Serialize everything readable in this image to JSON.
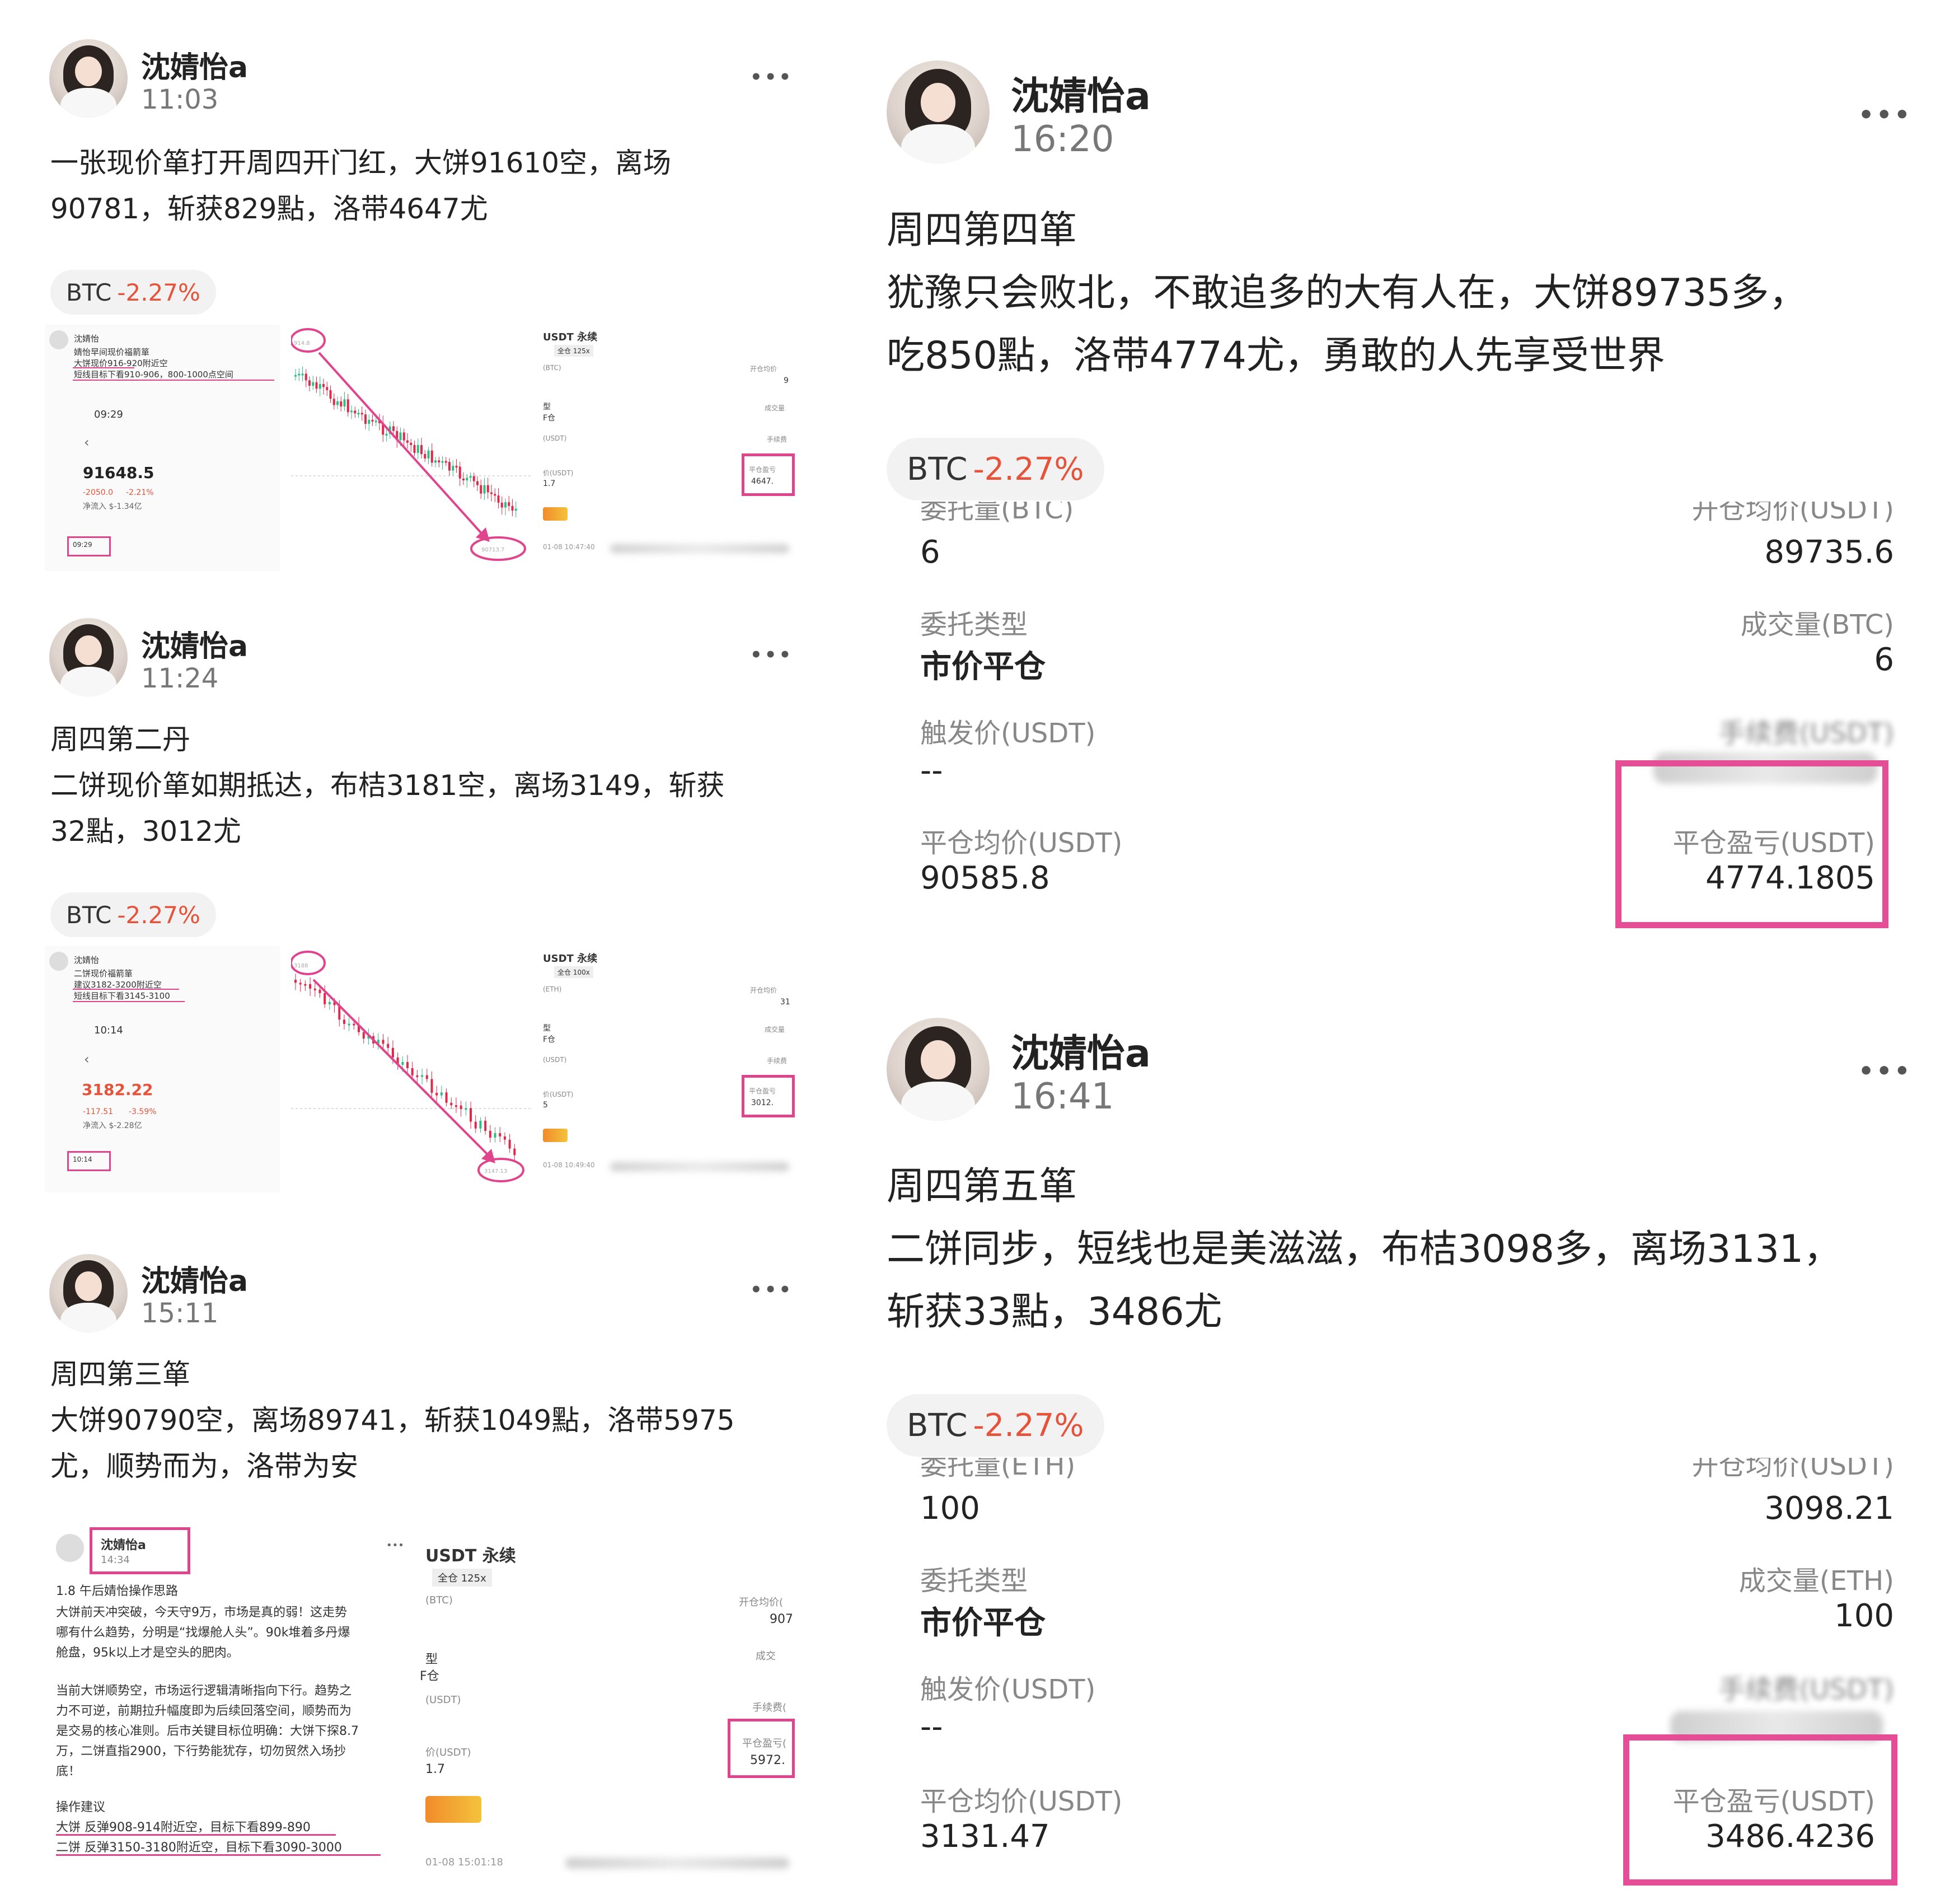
{
  "author": "沈婧怡a",
  "more": "•••",
  "badge": {
    "symbol": "BTC",
    "change": "-2.27%"
  },
  "posts": [
    {
      "time": "11:03",
      "lines": [
        "一张现价箪打开周四开门红，大饼91610空，离场",
        "90781，斩获829點，洛带4647尤"
      ],
      "shot": {
        "name": "沈婧怡",
        "note1": "婧怡早间现价福箭箪",
        "note2": "大饼现价916-920附近空",
        "note3": "短线目标下看910-906，800-1000点空间",
        "ctime": "09:29",
        "price": "91648.5",
        "chg_abs": "-2050.0",
        "chg_pct": "-2.21%",
        "flow": "净流入  $-1.34亿",
        "mini_time": "09:29",
        "usdt_title": "USDT 永续",
        "leverage": "全仓 125x",
        "coin": "(BTC)",
        "open_avg_label": "开仓均价",
        "type_label": "型",
        "type_value": "F仓",
        "usdt_unit": "(USDT)",
        "close_price_label": "价(USDT)",
        "close_price_value": "1.7",
        "pnl_label": "平仓盈亏",
        "pnl_value": "4647.",
        "fee_label": "手续费",
        "deal_label": "成交量",
        "open_avg_value": "9",
        "date": "01-08 10:47:40",
        "hi_tag": "914.8",
        "lo_tag": "90713.7"
      }
    },
    {
      "time": "11:24",
      "lines": [
        "周四第二丹",
        "二饼现价箪如期抵达，布桔3181空，离场3149，斩获",
        "32點，3012尤"
      ],
      "shot": {
        "name": "沈婧怡",
        "note1": "二饼现价福箭箪",
        "note2": "建议3182-3200附近空",
        "note3": "短线目标下看3145-3100",
        "ctime": "10:14",
        "price": "3182.22",
        "chg_abs": "-117.51",
        "chg_pct": "-3.59%",
        "flow": "净流入  $-2.28亿",
        "mini_time": "10:14",
        "usdt_title": "USDT 永续",
        "leverage": "全仓 100x",
        "coin": "(ETH)",
        "open_avg_label": "开仓均价",
        "type_label": "型",
        "type_value": "F仓",
        "usdt_unit": "(USDT)",
        "close_price_label": "价(USDT)",
        "close_price_value": "5",
        "pnl_label": "平仓盈亏",
        "pnl_value": "3012.",
        "fee_label": "手续费",
        "deal_label": "成交量",
        "open_avg_value": "31",
        "date": "01-08 10:49:40",
        "hi_tag": "3188",
        "lo_tag": "3147.13"
      }
    },
    {
      "time": "15:11",
      "lines": [
        "周四第三箪",
        "大饼90790空，离场89741，斩获1049點，洛带5975",
        "尤，顺势而为，洛带为安"
      ],
      "shot": {
        "name": "沈婧怡a",
        "ptime": "14:34",
        "title": "1.8  午后婧怡操作思路",
        "para1": [
          "大饼前天冲突破，今天守9万，市场是真的弱！这走势",
          "哪有什么趋势，分明是“找爆舱人头”。90k堆着多丹爆",
          "舱盘，95k以上才是空头的肥肉。"
        ],
        "para2": [
          "当前大饼顺势空，市场运行逻辑清晰指向下行。趋势之",
          "力不可逆，前期拉升幅度即为后续回落空间，顺势而为",
          "是交易的核心准则。后市关键目标位明确：大饼下探8.7",
          "万，二饼直指2900，下行势能犹存，切勿贸然入场抄",
          "底！"
        ],
        "advice_title": "操作建议",
        "advice1": "大饼 反弹908-914附近空，目标下看899-890",
        "advice2": "二饼 反弹3150-3180附近空，目标下看3090-3000",
        "usdt_title": "USDT 永续",
        "leverage": "全仓 125x",
        "coin": "(BTC)",
        "open_avg_label": "开仓均价(",
        "open_avg_value": "907",
        "type_label": "型",
        "type_value": "F仓",
        "deal_label": "成交",
        "usdt_unit": "(USDT)",
        "fee_label": "手续费(",
        "close_price_label": "价(USDT)",
        "close_price_value": "1.7",
        "pnl_label": "平仓盈亏(",
        "pnl_value": "5972.",
        "date": "01-08 15:01:18",
        "dots": "•••"
      }
    },
    {
      "time": "16:20",
      "lines": [
        "周四第四箪",
        "犹豫只会败北，不敢追多的大有人在，大饼89735多，",
        "吃850點，洛带4774尤，勇敢的人先享受世界"
      ],
      "detail": {
        "qty_label": "委托量(BTC)",
        "qty_value": "6",
        "open_label": "开仓均价(USDT)",
        "open_value": "89735.6",
        "type_label": "委托类型",
        "type_value": "市价平仓",
        "deal_label": "成交量(BTC)",
        "deal_value": "6",
        "trigger_label": "触发价(USDT)",
        "trigger_value": "--",
        "fee_label": "手续费(USDT)",
        "close_avg_label": "平仓均价(USDT)",
        "close_avg_value": "90585.8",
        "pnl_label": "平仓盈亏(USDT)",
        "pnl_value": "4774.1805"
      }
    },
    {
      "time": "16:41",
      "lines": [
        "周四第五箪",
        "二饼同步，短线也是美滋滋，布桔3098多，离场3131，",
        "斩获33點，3486尤"
      ],
      "detail": {
        "qty_label": "委托量(ETH)",
        "qty_value": "100",
        "open_label": "开仓均价(USDT)",
        "open_value": "3098.21",
        "type_label": "委托类型",
        "type_value": "市价平仓",
        "deal_label": "成交量(ETH)",
        "deal_value": "100",
        "trigger_label": "触发价(USDT)",
        "trigger_value": "--",
        "fee_label": "手续费(USDT)",
        "close_avg_label": "平仓均价(USDT)",
        "close_avg_value": "3131.47",
        "pnl_label": "平仓盈亏(USDT)",
        "pnl_value": "3486.4236"
      }
    }
  ]
}
